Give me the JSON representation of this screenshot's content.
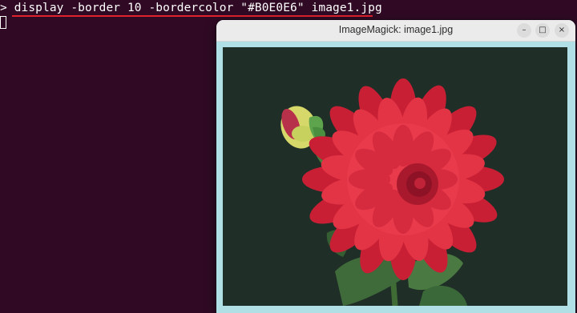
{
  "terminal": {
    "prompt": ">",
    "command": "display -border 10 -bordercolor \"#B0E0E6\" image1.jpg"
  },
  "window": {
    "title": "ImageMagick: image1.jpg",
    "buttons": {
      "minimize": "–",
      "maximize": "□",
      "close": "×"
    }
  },
  "colors": {
    "terminal_bg": "#300a24",
    "underline": "#e0222e",
    "border_color": "#B0E0E6",
    "photo_bg": "#1f2f27",
    "flower": "#e23444"
  },
  "icons": [
    "minimize-icon",
    "maximize-icon",
    "close-icon"
  ]
}
